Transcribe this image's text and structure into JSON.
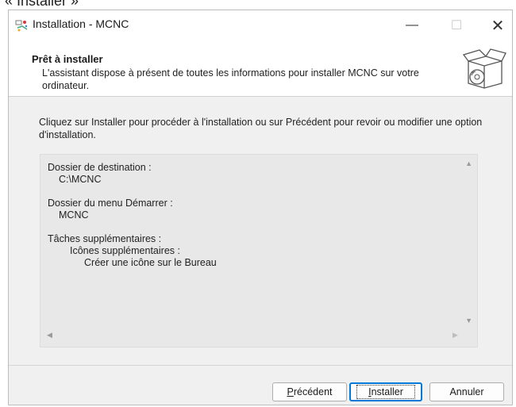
{
  "caption": "« Installer »",
  "window": {
    "title": "Installation - MCNC",
    "controls": {
      "minimize": "—",
      "maximize": "☐",
      "close": "✕"
    }
  },
  "header": {
    "title": "Prêt à installer",
    "subtitle": "L'assistant dispose à présent de toutes les informations pour installer MCNC sur votre ordinateur."
  },
  "instructions": "Cliquez sur Installer pour procéder à l'installation ou sur Précédent pour revoir ou modifier une option d'installation.",
  "memo": {
    "dest_label": "Dossier de destination :",
    "dest_value": "C:\\MCNC",
    "startmenu_label": "Dossier du menu Démarrer :",
    "startmenu_value": "MCNC",
    "tasks_label": "Tâches supplémentaires :",
    "tasks_group": "Icônes supplémentaires :",
    "tasks_item": "Créer une icône sur le Bureau"
  },
  "buttons": {
    "prev_first": "P",
    "prev_rest": "récédent",
    "install_first": "I",
    "install_rest": "nstaller",
    "cancel": "Annuler"
  },
  "colors": {
    "accent": "#0078d7",
    "dialog_bg": "#f0f0f0",
    "memo_bg": "#e8e8e8"
  }
}
